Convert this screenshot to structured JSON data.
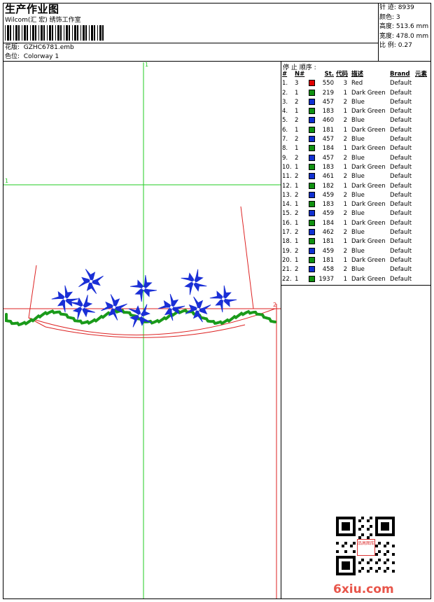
{
  "header": {
    "title": "生产作业图",
    "subtitle": "Wilcom(汇 宏) 绣饰工作室",
    "file_label": "花版:",
    "file_value": "GZHC6781.emb",
    "colorway_label": "色位:",
    "colorway_value": "Colorway 1"
  },
  "stats": [
    {
      "label": "针 迹:",
      "value": "8939"
    },
    {
      "label": "颜色:",
      "value": "3"
    },
    {
      "label": "高度:",
      "value": "513.6 mm"
    },
    {
      "label": "宽度:",
      "value": "478.0 mm"
    },
    {
      "label": "比 例:",
      "value": "0.27"
    }
  ],
  "legend": {
    "title": "停 止 顺序 :",
    "headers": [
      "#",
      "N#",
      "St.",
      "代码",
      "描述",
      "Brand",
      "元素"
    ],
    "rows": [
      {
        "n": "1.",
        "code": "3",
        "st": "550",
        "cnum": "3",
        "desc": "Red",
        "brand": "Default",
        "color": "#e00000"
      },
      {
        "n": "2.",
        "code": "1",
        "st": "219",
        "cnum": "1",
        "desc": "Dark Green",
        "brand": "Default",
        "color": "#109010"
      },
      {
        "n": "3.",
        "code": "2",
        "st": "457",
        "cnum": "2",
        "desc": "Blue",
        "brand": "Default",
        "color": "#1030d0"
      },
      {
        "n": "4.",
        "code": "1",
        "st": "183",
        "cnum": "1",
        "desc": "Dark Green",
        "brand": "Default",
        "color": "#109010"
      },
      {
        "n": "5.",
        "code": "2",
        "st": "460",
        "cnum": "2",
        "desc": "Blue",
        "brand": "Default",
        "color": "#1030d0"
      },
      {
        "n": "6.",
        "code": "1",
        "st": "181",
        "cnum": "1",
        "desc": "Dark Green",
        "brand": "Default",
        "color": "#109010"
      },
      {
        "n": "7.",
        "code": "2",
        "st": "457",
        "cnum": "2",
        "desc": "Blue",
        "brand": "Default",
        "color": "#1030d0"
      },
      {
        "n": "8.",
        "code": "1",
        "st": "184",
        "cnum": "1",
        "desc": "Dark Green",
        "brand": "Default",
        "color": "#109010"
      },
      {
        "n": "9.",
        "code": "2",
        "st": "457",
        "cnum": "2",
        "desc": "Blue",
        "brand": "Default",
        "color": "#1030d0"
      },
      {
        "n": "10.",
        "code": "1",
        "st": "183",
        "cnum": "1",
        "desc": "Dark Green",
        "brand": "Default",
        "color": "#109010"
      },
      {
        "n": "11.",
        "code": "2",
        "st": "461",
        "cnum": "2",
        "desc": "Blue",
        "brand": "Default",
        "color": "#1030d0"
      },
      {
        "n": "12.",
        "code": "1",
        "st": "182",
        "cnum": "1",
        "desc": "Dark Green",
        "brand": "Default",
        "color": "#109010"
      },
      {
        "n": "13.",
        "code": "2",
        "st": "459",
        "cnum": "2",
        "desc": "Blue",
        "brand": "Default",
        "color": "#1030d0"
      },
      {
        "n": "14.",
        "code": "1",
        "st": "183",
        "cnum": "1",
        "desc": "Dark Green",
        "brand": "Default",
        "color": "#109010"
      },
      {
        "n": "15.",
        "code": "2",
        "st": "459",
        "cnum": "2",
        "desc": "Blue",
        "brand": "Default",
        "color": "#1030d0"
      },
      {
        "n": "16.",
        "code": "1",
        "st": "184",
        "cnum": "1",
        "desc": "Dark Green",
        "brand": "Default",
        "color": "#109010"
      },
      {
        "n": "17.",
        "code": "2",
        "st": "462",
        "cnum": "2",
        "desc": "Blue",
        "brand": "Default",
        "color": "#1030d0"
      },
      {
        "n": "18.",
        "code": "1",
        "st": "181",
        "cnum": "1",
        "desc": "Dark Green",
        "brand": "Default",
        "color": "#109010"
      },
      {
        "n": "19.",
        "code": "2",
        "st": "459",
        "cnum": "2",
        "desc": "Blue",
        "brand": "Default",
        "color": "#1030d0"
      },
      {
        "n": "20.",
        "code": "1",
        "st": "181",
        "cnum": "1",
        "desc": "Dark Green",
        "brand": "Default",
        "color": "#109010"
      },
      {
        "n": "21.",
        "code": "2",
        "st": "458",
        "cnum": "2",
        "desc": "Blue",
        "brand": "Default",
        "color": "#1030d0"
      },
      {
        "n": "22.",
        "code": "1",
        "st": "1937",
        "cnum": "1",
        "desc": "Dark Green",
        "brand": "Default",
        "color": "#109010"
      }
    ]
  },
  "canvas": {
    "marker_top": "1",
    "marker_left": "1",
    "marker_right": "2",
    "guide_color": "#22cc22",
    "outline_color": "#dd2222",
    "flower_color": "#1a2fd6",
    "vine_color": "#1a9a1a"
  },
  "watermark": {
    "qr_stamp": "品高图库",
    "text": "6xiu.com"
  }
}
